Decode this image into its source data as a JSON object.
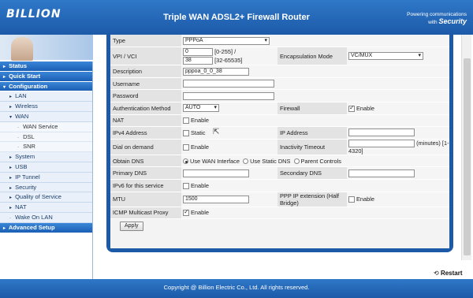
{
  "header": {
    "logo": "BILLION",
    "title": "Triple WAN ADSL2+ Firewall Router",
    "tagline_small": "Powering communications",
    "tagline_with": "with",
    "tagline_brand": "Security"
  },
  "sidebar": {
    "items": [
      {
        "label": "Status",
        "kind": "top",
        "arrow": "▸"
      },
      {
        "label": "Quick Start",
        "kind": "top",
        "arrow": "▸"
      },
      {
        "label": "Configuration",
        "kind": "top",
        "arrow": "▾"
      },
      {
        "label": "LAN",
        "kind": "sub",
        "arrow": "▸"
      },
      {
        "label": "Wireless",
        "kind": "sub",
        "arrow": "▸"
      },
      {
        "label": "WAN",
        "kind": "sub",
        "arrow": "▾"
      },
      {
        "label": "WAN Service",
        "kind": "subsub",
        "arrow": "·"
      },
      {
        "label": "DSL",
        "kind": "subsub",
        "arrow": "·"
      },
      {
        "label": "SNR",
        "kind": "subsub",
        "arrow": "·"
      },
      {
        "label": "System",
        "kind": "sub",
        "arrow": "▸"
      },
      {
        "label": "USB",
        "kind": "sub",
        "arrow": "▸"
      },
      {
        "label": "IP Tunnel",
        "kind": "sub",
        "arrow": "▸"
      },
      {
        "label": "Security",
        "kind": "sub",
        "arrow": "▸"
      },
      {
        "label": "Quality of Service",
        "kind": "sub",
        "arrow": "▸"
      },
      {
        "label": "NAT",
        "kind": "sub",
        "arrow": "▸"
      },
      {
        "label": "Wake On LAN",
        "kind": "sub",
        "arrow": "·"
      },
      {
        "label": "Advanced Setup",
        "kind": "top",
        "arrow": "▸"
      }
    ]
  },
  "form": {
    "type_label": "Type",
    "type_value": "PPPoA",
    "vpi_label": "VPI / VCI",
    "vpi_value": "0",
    "vpi_range": "[0-255] /",
    "vci_value": "38",
    "vci_range": "[32-65535]",
    "encap_label": "Encapsulation Mode",
    "encap_value": "VC/MUX",
    "desc_label": "Description",
    "desc_value": "pppoa_0_0_38",
    "user_label": "Username",
    "user_value": "",
    "pass_label": "Password",
    "pass_value": "",
    "auth_label": "Authentication Method",
    "auth_value": "AUTO",
    "firewall_label": "Firewall",
    "firewall_enable": "Enable",
    "nat_label": "NAT",
    "nat_enable": "Enable",
    "ipv4_label": "IPv4 Address",
    "ipv4_static": "Static",
    "ip_label": "IP Address",
    "ip_value": "",
    "dod_label": "Dial on demand",
    "dod_enable": "Enable",
    "inact_label": "Inactivity Timeout",
    "inact_value": "",
    "inact_suffix": "(minutes) [1-4320]",
    "dns_label": "Obtain DNS",
    "dns_opt1": "Use WAN Interface",
    "dns_opt2": "Use Static DNS",
    "dns_opt3": "Parent Controls",
    "pdns_label": "Primary DNS",
    "pdns_value": "",
    "sdns_label": "Secondary DNS",
    "sdns_value": "",
    "ipv6_label": "IPv6 for this service",
    "ipv6_enable": "Enable",
    "mtu_label": "MTU",
    "mtu_value": "1500",
    "pppip_label": "PPP IP extension (Half Bridge)",
    "pppip_enable": "Enable",
    "icmp_label": "ICMP Multicast Proxy",
    "icmp_enable": "Enable",
    "apply_label": "Apply"
  },
  "restart_label": "Restart",
  "footer": "Copyright @ Billion Electric Co., Ltd. All rights reserved."
}
